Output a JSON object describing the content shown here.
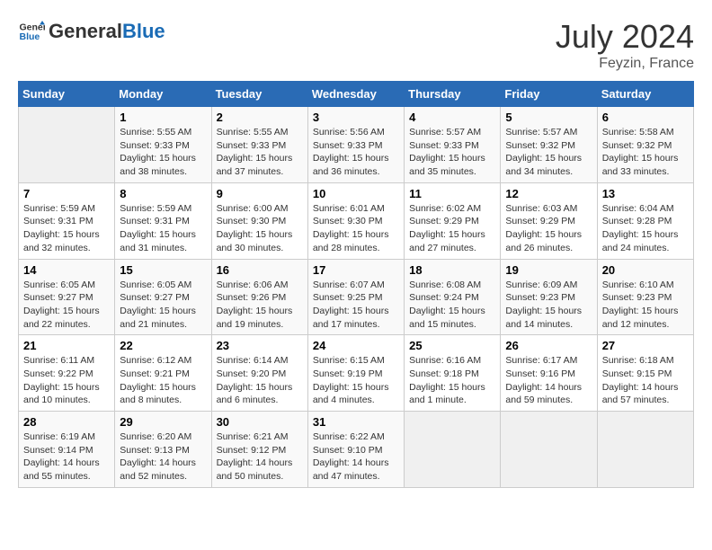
{
  "header": {
    "logo_general": "General",
    "logo_blue": "Blue",
    "month_year": "July 2024",
    "location": "Feyzin, France"
  },
  "days_of_week": [
    "Sunday",
    "Monday",
    "Tuesday",
    "Wednesday",
    "Thursday",
    "Friday",
    "Saturday"
  ],
  "weeks": [
    [
      {
        "day": "",
        "info": ""
      },
      {
        "day": "1",
        "info": "Sunrise: 5:55 AM\nSunset: 9:33 PM\nDaylight: 15 hours\nand 38 minutes."
      },
      {
        "day": "2",
        "info": "Sunrise: 5:55 AM\nSunset: 9:33 PM\nDaylight: 15 hours\nand 37 minutes."
      },
      {
        "day": "3",
        "info": "Sunrise: 5:56 AM\nSunset: 9:33 PM\nDaylight: 15 hours\nand 36 minutes."
      },
      {
        "day": "4",
        "info": "Sunrise: 5:57 AM\nSunset: 9:33 PM\nDaylight: 15 hours\nand 35 minutes."
      },
      {
        "day": "5",
        "info": "Sunrise: 5:57 AM\nSunset: 9:32 PM\nDaylight: 15 hours\nand 34 minutes."
      },
      {
        "day": "6",
        "info": "Sunrise: 5:58 AM\nSunset: 9:32 PM\nDaylight: 15 hours\nand 33 minutes."
      }
    ],
    [
      {
        "day": "7",
        "info": "Sunrise: 5:59 AM\nSunset: 9:31 PM\nDaylight: 15 hours\nand 32 minutes."
      },
      {
        "day": "8",
        "info": "Sunrise: 5:59 AM\nSunset: 9:31 PM\nDaylight: 15 hours\nand 31 minutes."
      },
      {
        "day": "9",
        "info": "Sunrise: 6:00 AM\nSunset: 9:30 PM\nDaylight: 15 hours\nand 30 minutes."
      },
      {
        "day": "10",
        "info": "Sunrise: 6:01 AM\nSunset: 9:30 PM\nDaylight: 15 hours\nand 28 minutes."
      },
      {
        "day": "11",
        "info": "Sunrise: 6:02 AM\nSunset: 9:29 PM\nDaylight: 15 hours\nand 27 minutes."
      },
      {
        "day": "12",
        "info": "Sunrise: 6:03 AM\nSunset: 9:29 PM\nDaylight: 15 hours\nand 26 minutes."
      },
      {
        "day": "13",
        "info": "Sunrise: 6:04 AM\nSunset: 9:28 PM\nDaylight: 15 hours\nand 24 minutes."
      }
    ],
    [
      {
        "day": "14",
        "info": "Sunrise: 6:05 AM\nSunset: 9:27 PM\nDaylight: 15 hours\nand 22 minutes."
      },
      {
        "day": "15",
        "info": "Sunrise: 6:05 AM\nSunset: 9:27 PM\nDaylight: 15 hours\nand 21 minutes."
      },
      {
        "day": "16",
        "info": "Sunrise: 6:06 AM\nSunset: 9:26 PM\nDaylight: 15 hours\nand 19 minutes."
      },
      {
        "day": "17",
        "info": "Sunrise: 6:07 AM\nSunset: 9:25 PM\nDaylight: 15 hours\nand 17 minutes."
      },
      {
        "day": "18",
        "info": "Sunrise: 6:08 AM\nSunset: 9:24 PM\nDaylight: 15 hours\nand 15 minutes."
      },
      {
        "day": "19",
        "info": "Sunrise: 6:09 AM\nSunset: 9:23 PM\nDaylight: 15 hours\nand 14 minutes."
      },
      {
        "day": "20",
        "info": "Sunrise: 6:10 AM\nSunset: 9:23 PM\nDaylight: 15 hours\nand 12 minutes."
      }
    ],
    [
      {
        "day": "21",
        "info": "Sunrise: 6:11 AM\nSunset: 9:22 PM\nDaylight: 15 hours\nand 10 minutes."
      },
      {
        "day": "22",
        "info": "Sunrise: 6:12 AM\nSunset: 9:21 PM\nDaylight: 15 hours\nand 8 minutes."
      },
      {
        "day": "23",
        "info": "Sunrise: 6:14 AM\nSunset: 9:20 PM\nDaylight: 15 hours\nand 6 minutes."
      },
      {
        "day": "24",
        "info": "Sunrise: 6:15 AM\nSunset: 9:19 PM\nDaylight: 15 hours\nand 4 minutes."
      },
      {
        "day": "25",
        "info": "Sunrise: 6:16 AM\nSunset: 9:18 PM\nDaylight: 15 hours\nand 1 minute."
      },
      {
        "day": "26",
        "info": "Sunrise: 6:17 AM\nSunset: 9:16 PM\nDaylight: 14 hours\nand 59 minutes."
      },
      {
        "day": "27",
        "info": "Sunrise: 6:18 AM\nSunset: 9:15 PM\nDaylight: 14 hours\nand 57 minutes."
      }
    ],
    [
      {
        "day": "28",
        "info": "Sunrise: 6:19 AM\nSunset: 9:14 PM\nDaylight: 14 hours\nand 55 minutes."
      },
      {
        "day": "29",
        "info": "Sunrise: 6:20 AM\nSunset: 9:13 PM\nDaylight: 14 hours\nand 52 minutes."
      },
      {
        "day": "30",
        "info": "Sunrise: 6:21 AM\nSunset: 9:12 PM\nDaylight: 14 hours\nand 50 minutes."
      },
      {
        "day": "31",
        "info": "Sunrise: 6:22 AM\nSunset: 9:10 PM\nDaylight: 14 hours\nand 47 minutes."
      },
      {
        "day": "",
        "info": ""
      },
      {
        "day": "",
        "info": ""
      },
      {
        "day": "",
        "info": ""
      }
    ]
  ]
}
